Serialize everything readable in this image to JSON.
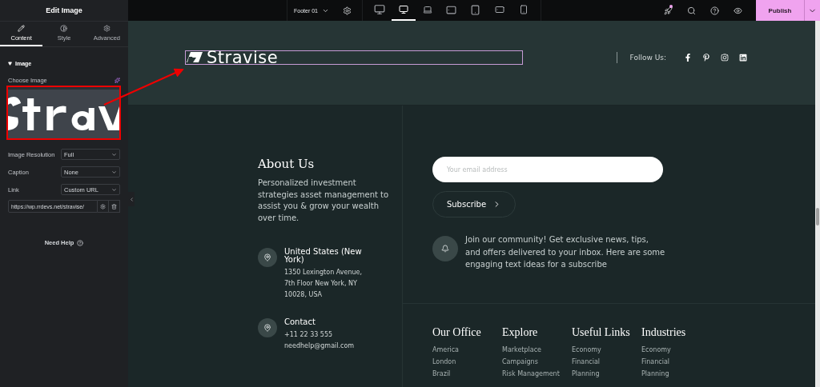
{
  "panel": {
    "title": "Edit Image",
    "tabs": [
      {
        "label": "Content",
        "kind": "pencil",
        "selected": true
      },
      {
        "label": "Style",
        "kind": "contrast",
        "selected": false
      },
      {
        "label": "Advanced",
        "kind": "gear",
        "selected": false
      }
    ],
    "section": {
      "title": "Image",
      "expanded": true
    },
    "choose_label": "Choose Image",
    "fields": [
      {
        "label": "Image Resolution",
        "value": "Full"
      },
      {
        "label": "Caption",
        "value": "None"
      },
      {
        "label": "Link",
        "value": "Custom URL"
      }
    ],
    "url": "https://wp.rrdevs.net/stravise/",
    "help": "Need Help"
  },
  "topbar": {
    "page": "Footer 01",
    "devices": [
      {
        "kind": "desktop-wide",
        "selected": false
      },
      {
        "kind": "desktop",
        "selected": true
      },
      {
        "kind": "laptop",
        "selected": false
      },
      {
        "kind": "tablet-landscape",
        "selected": false
      },
      {
        "kind": "tablet",
        "selected": false
      },
      {
        "kind": "mobile-landscape",
        "selected": false
      },
      {
        "kind": "mobile",
        "selected": false
      }
    ],
    "publish": "Publish"
  },
  "canvas": {
    "logo": "Stravise",
    "follow_label": "Follow Us:",
    "socials": [
      {
        "kind": "facebook"
      },
      {
        "kind": "pinterest"
      },
      {
        "kind": "instagram"
      },
      {
        "kind": "linkedin"
      }
    ],
    "about": {
      "title": "About Us",
      "text": "Personalized investment strategies asset management to assist you & grow your wealth over time."
    },
    "contacts": [
      {
        "title": "United States (New York)",
        "lines": [
          "1350 Lexington Avenue,",
          "7th Floor New York, NY",
          "10028, USA"
        ]
      },
      {
        "title": "Contact",
        "lines": [
          "+11 22 33 555",
          "needhelp@gmail.com"
        ]
      }
    ],
    "email_placeholder": "Your email address",
    "subscribe": "Subscribe",
    "community": "Join our community! Get exclusive news, tips, and offers delivered to your inbox. Here are some engaging text ideas for a subscribe",
    "columns": [
      {
        "title": "Our Office",
        "links": [
          "America",
          "London",
          "Brazil"
        ]
      },
      {
        "title": "Explore",
        "links": [
          "Marketplace",
          "Campaigns",
          "Risk Management"
        ]
      },
      {
        "title": "Useful Links",
        "links": [
          "Economy",
          "Financial",
          "Planning"
        ]
      },
      {
        "title": "Industries",
        "links": [
          "Economy",
          "Financial",
          "Planning"
        ]
      }
    ]
  }
}
